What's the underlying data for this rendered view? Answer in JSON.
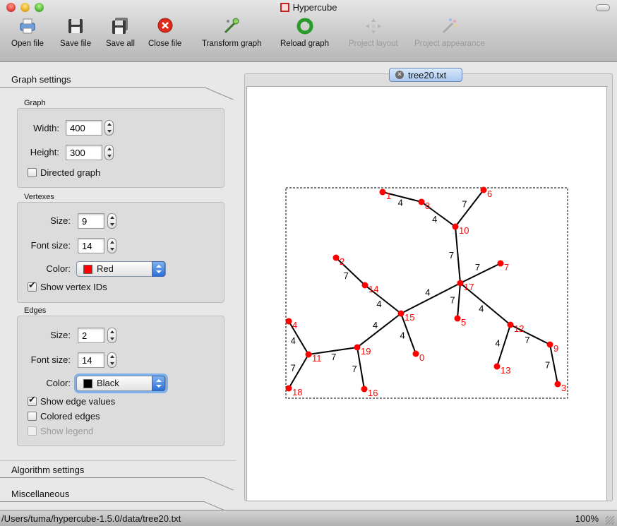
{
  "window": {
    "title": "Hypercube"
  },
  "toolbar": {
    "open_file": "Open file",
    "save_file": "Save file",
    "save_all": "Save all",
    "close_file": "Close file",
    "transform_graph": "Transform graph",
    "reload_graph": "Reload graph",
    "project_layout": "Project layout",
    "project_appearance": "Project appearance"
  },
  "sidebar": {
    "graph_settings": "Graph settings",
    "graph_group": {
      "label": "Graph",
      "width_label": "Width:",
      "width_value": "400",
      "height_label": "Height:",
      "height_value": "300",
      "directed_label": "Directed graph",
      "directed_checked": false
    },
    "vertexes_group": {
      "label": "Vertexes",
      "size_label": "Size:",
      "size_value": "9",
      "font_size_label": "Font size:",
      "font_size_value": "14",
      "color_label": "Color:",
      "color_value": "Red",
      "color_swatch": "#ff0000",
      "show_ids_label": "Show vertex IDs",
      "show_ids_checked": true
    },
    "edges_group": {
      "label": "Edges",
      "size_label": "Size:",
      "size_value": "2",
      "font_size_label": "Font size:",
      "font_size_value": "14",
      "color_label": "Color:",
      "color_value": "Black",
      "color_swatch": "#000000",
      "show_values_label": "Show edge values",
      "show_values_checked": true,
      "colored_edges_label": "Colored edges",
      "colored_edges_checked": false,
      "show_legend_label": "Show legend",
      "show_legend_checked": false
    },
    "algorithm_settings": "Algorithm settings",
    "miscellaneous": "Miscellaneous"
  },
  "tab": {
    "label": "tree20.txt"
  },
  "graph": {
    "vertex_color": "#ff0000",
    "edge_color": "#000000",
    "vertices": [
      {
        "id": "1"
      },
      {
        "id": "8"
      },
      {
        "id": "6"
      },
      {
        "id": "10"
      },
      {
        "id": "2"
      },
      {
        "id": "14"
      },
      {
        "id": "7"
      },
      {
        "id": "17"
      },
      {
        "id": "15"
      },
      {
        "id": "5"
      },
      {
        "id": "4"
      },
      {
        "id": "12"
      },
      {
        "id": "9"
      },
      {
        "id": "11"
      },
      {
        "id": "19"
      },
      {
        "id": "0"
      },
      {
        "id": "13"
      },
      {
        "id": "3"
      },
      {
        "id": "18"
      },
      {
        "id": "16"
      }
    ],
    "edges": [
      {
        "from": "1",
        "to": "8",
        "value": "4"
      },
      {
        "from": "8",
        "to": "10",
        "value": "4"
      },
      {
        "from": "6",
        "to": "10",
        "value": "7"
      },
      {
        "from": "10",
        "to": "17",
        "value": "7"
      },
      {
        "from": "7",
        "to": "17",
        "value": "7"
      },
      {
        "from": "17",
        "to": "15",
        "value": "4"
      },
      {
        "from": "17",
        "to": "5",
        "value": "7"
      },
      {
        "from": "17",
        "to": "12",
        "value": "4"
      },
      {
        "from": "2",
        "to": "14",
        "value": "7"
      },
      {
        "from": "14",
        "to": "15",
        "value": "4"
      },
      {
        "from": "15",
        "to": "0",
        "value": "4"
      },
      {
        "from": "15",
        "to": "19",
        "value": "4"
      },
      {
        "from": "12",
        "to": "13",
        "value": "4"
      },
      {
        "from": "12",
        "to": "9",
        "value": "7"
      },
      {
        "from": "9",
        "to": "3",
        "value": "7"
      },
      {
        "from": "4",
        "to": "11",
        "value": "4"
      },
      {
        "from": "11",
        "to": "19",
        "value": "7"
      },
      {
        "from": "11",
        "to": "18",
        "value": "7"
      },
      {
        "from": "19",
        "to": "16",
        "value": "7"
      }
    ]
  },
  "statusbar": {
    "path": "/Users/tuma/hypercube-1.5.0/data/tree20.txt",
    "zoom": "100%"
  }
}
